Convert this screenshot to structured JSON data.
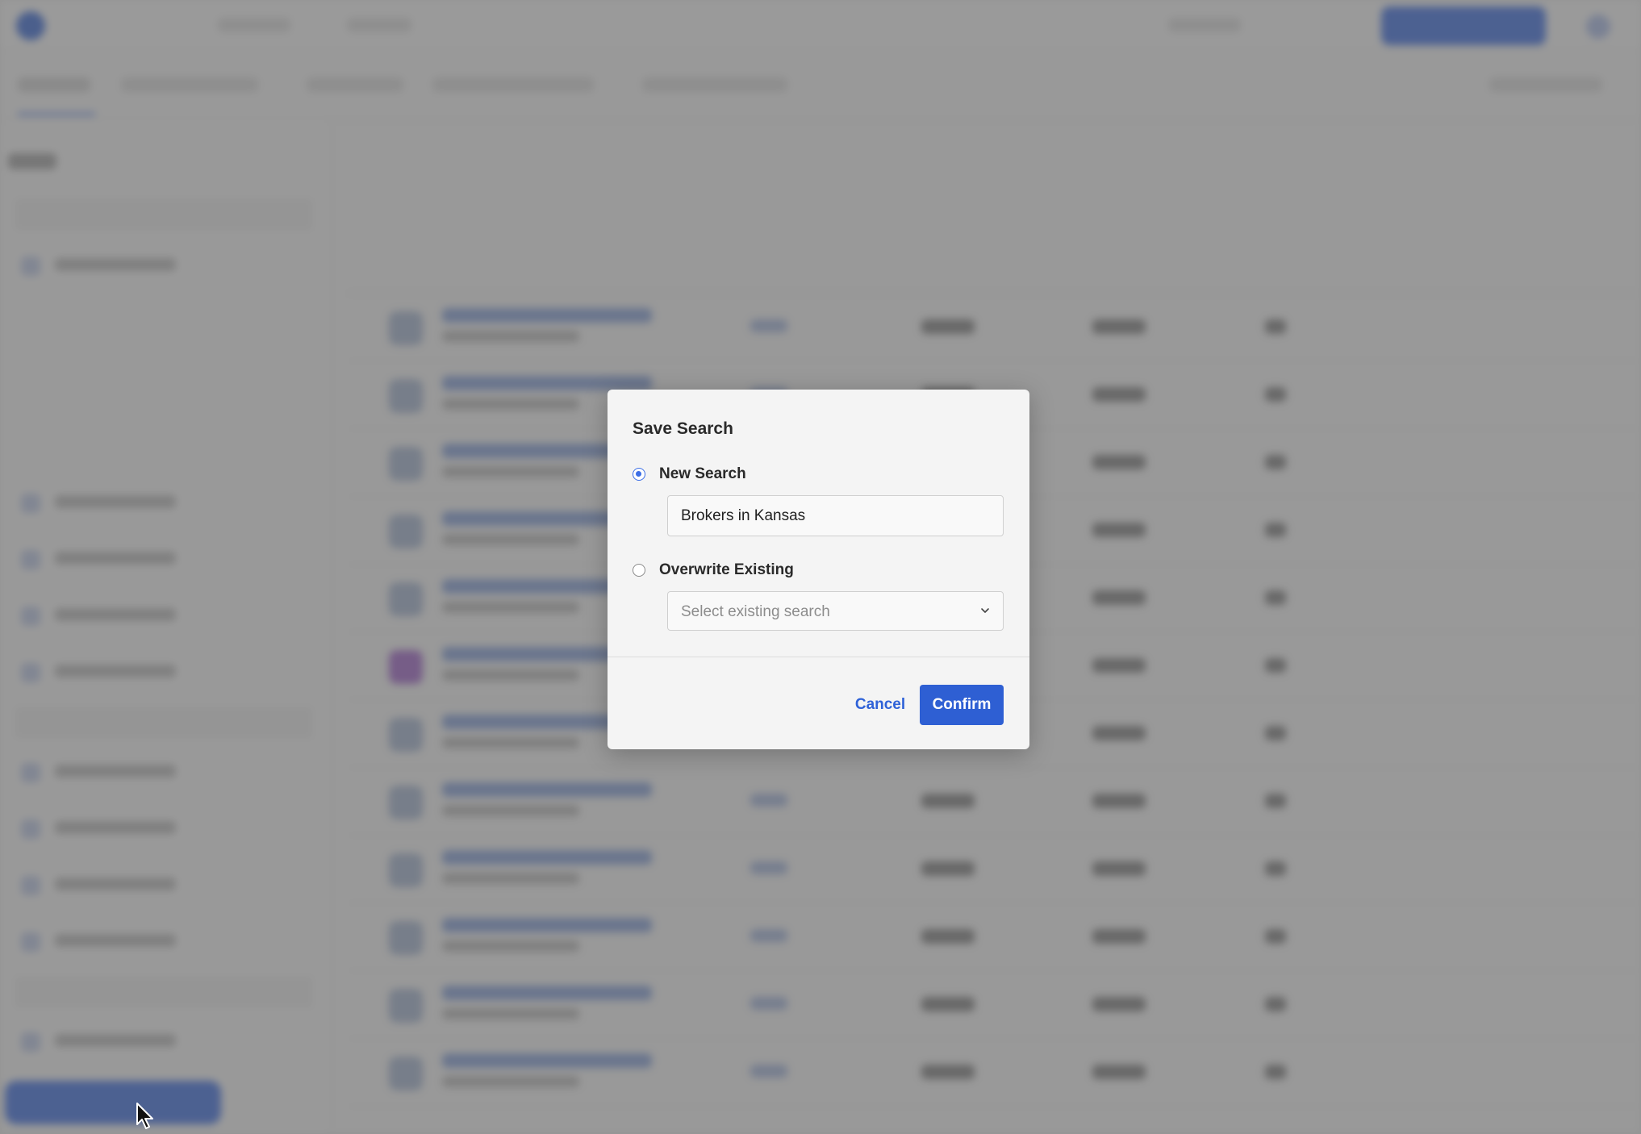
{
  "modal": {
    "title": "Save Search",
    "new_search_label": "New Search",
    "new_search_value": "Brokers in Kansas",
    "new_search_selected": true,
    "overwrite_label": "Overwrite Existing",
    "overwrite_selected": false,
    "select_placeholder": "Select existing search",
    "cancel_label": "Cancel",
    "confirm_label": "Confirm"
  },
  "icons": {
    "select": "chevron-down-icon",
    "cursor": "mouse-pointer-icon"
  },
  "colors": {
    "primary": "#2e5fd3",
    "link": "#2f62d8",
    "radio_active": "#3c6ee6",
    "backdrop": "rgba(95,95,95,0.62)"
  }
}
